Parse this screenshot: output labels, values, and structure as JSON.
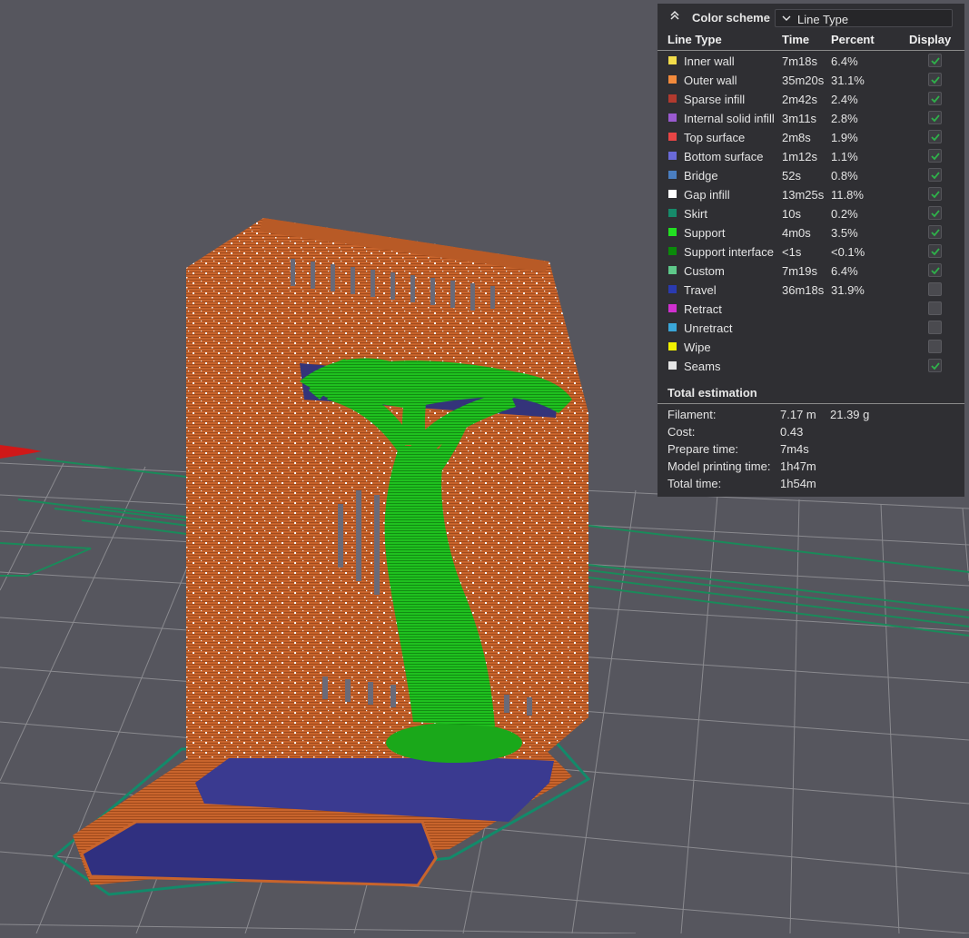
{
  "color_scheme": {
    "title": "Color scheme",
    "selected": "Line Type"
  },
  "columns": {
    "line_type": "Line Type",
    "time": "Time",
    "percent": "Percent",
    "display": "Display"
  },
  "rows": [
    {
      "label": "Inner wall",
      "time": "7m18s",
      "percent": "6.4%",
      "color": "#f2dc4a",
      "checked": true
    },
    {
      "label": "Outer wall",
      "time": "35m20s",
      "percent": "31.1%",
      "color": "#f28a3c",
      "checked": true
    },
    {
      "label": "Sparse infill",
      "time": "2m42s",
      "percent": "2.4%",
      "color": "#b23a2e",
      "checked": true
    },
    {
      "label": "Internal solid infill",
      "time": "3m11s",
      "percent": "2.8%",
      "color": "#9a5ad0",
      "checked": true
    },
    {
      "label": "Top surface",
      "time": "2m8s",
      "percent": "1.9%",
      "color": "#e84545",
      "checked": true
    },
    {
      "label": "Bottom surface",
      "time": "1m12s",
      "percent": "1.1%",
      "color": "#6a6ad8",
      "checked": true
    },
    {
      "label": "Bridge",
      "time": "52s",
      "percent": "0.8%",
      "color": "#4a7ec0",
      "checked": true
    },
    {
      "label": "Gap infill",
      "time": "13m25s",
      "percent": "11.8%",
      "color": "#ffffff",
      "checked": true
    },
    {
      "label": "Skirt",
      "time": "10s",
      "percent": "0.2%",
      "color": "#168a6a",
      "checked": true
    },
    {
      "label": "Support",
      "time": "4m0s",
      "percent": "3.5%",
      "color": "#22e022",
      "checked": true
    },
    {
      "label": "Support interface",
      "time": "<1s",
      "percent": "<0.1%",
      "color": "#0a8a0a",
      "checked": true
    },
    {
      "label": "Custom",
      "time": "7m19s",
      "percent": "6.4%",
      "color": "#5ec88a",
      "checked": true
    },
    {
      "label": "Travel",
      "time": "36m18s",
      "percent": "31.9%",
      "color": "#2a3ab0",
      "checked": false
    },
    {
      "label": "Retract",
      "time": "",
      "percent": "",
      "color": "#d030d0",
      "checked": false
    },
    {
      "label": "Unretract",
      "time": "",
      "percent": "",
      "color": "#3aa6d8",
      "checked": false
    },
    {
      "label": "Wipe",
      "time": "",
      "percent": "",
      "color": "#f0f000",
      "checked": false
    },
    {
      "label": "Seams",
      "time": "",
      "percent": "",
      "color": "#e6e6e6",
      "checked": true
    }
  ],
  "total": {
    "title": "Total estimation",
    "filament_label": "Filament:",
    "filament_length": "7.17 m",
    "filament_weight": "21.39 g",
    "cost_label": "Cost:",
    "cost": "0.43",
    "prepare_label": "Prepare time:",
    "prepare": "7m4s",
    "model_label": "Model printing time:",
    "model": "1h47m",
    "total_label": "Total time:",
    "total": "1h54m"
  }
}
